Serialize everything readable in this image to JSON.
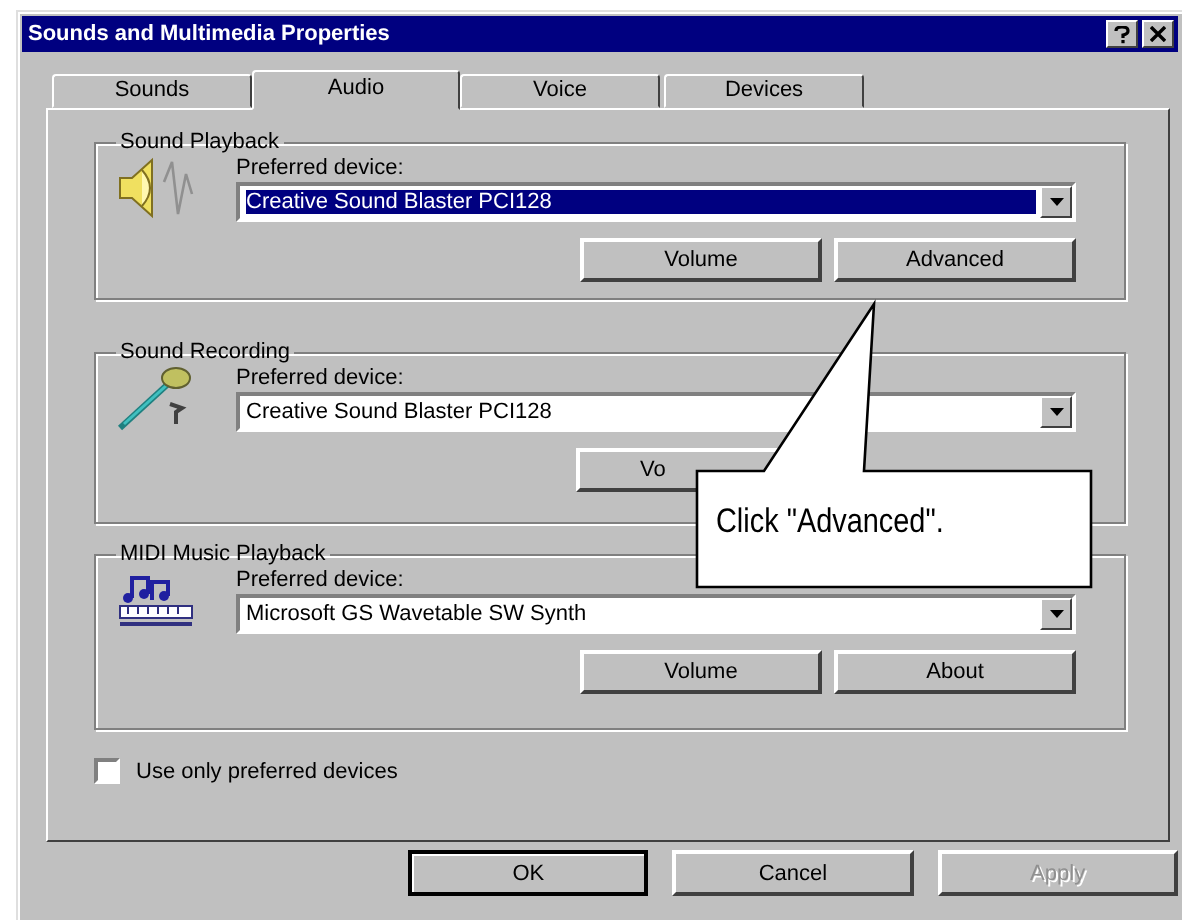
{
  "window": {
    "title": "Sounds and Multimedia Properties"
  },
  "tabs": [
    {
      "label": "Sounds",
      "selected": false
    },
    {
      "label": "Audio",
      "selected": true
    },
    {
      "label": "Voice",
      "selected": false
    },
    {
      "label": "Devices",
      "selected": false
    }
  ],
  "groups": [
    {
      "title": "Sound Playback",
      "kind": "speaker",
      "device_label": "Preferred device:",
      "device": "Creative Sound Blaster PCI128",
      "focused": true,
      "buttons": [
        "Volume",
        "Advanced"
      ]
    },
    {
      "title": "Sound Recording",
      "kind": "microphone",
      "device_label": "Preferred device:",
      "device": "Creative Sound Blaster PCI128",
      "focused": false,
      "buttons": [
        "Vo"
      ]
    },
    {
      "title": "MIDI Music Playback",
      "kind": "midi",
      "device_label": "Preferred device:",
      "device": "Microsoft GS Wavetable SW Synth",
      "focused": false,
      "buttons": [
        "Volume",
        "About"
      ]
    }
  ],
  "checkbox": {
    "label": "Use only preferred devices",
    "checked": false
  },
  "buttons": [
    {
      "label": "OK",
      "default": true,
      "disabled": false
    },
    {
      "label": "Cancel",
      "default": false,
      "disabled": false
    },
    {
      "label": "Apply",
      "default": false,
      "disabled": true
    }
  ],
  "callout": {
    "text": "Click \"Advanced\"."
  }
}
